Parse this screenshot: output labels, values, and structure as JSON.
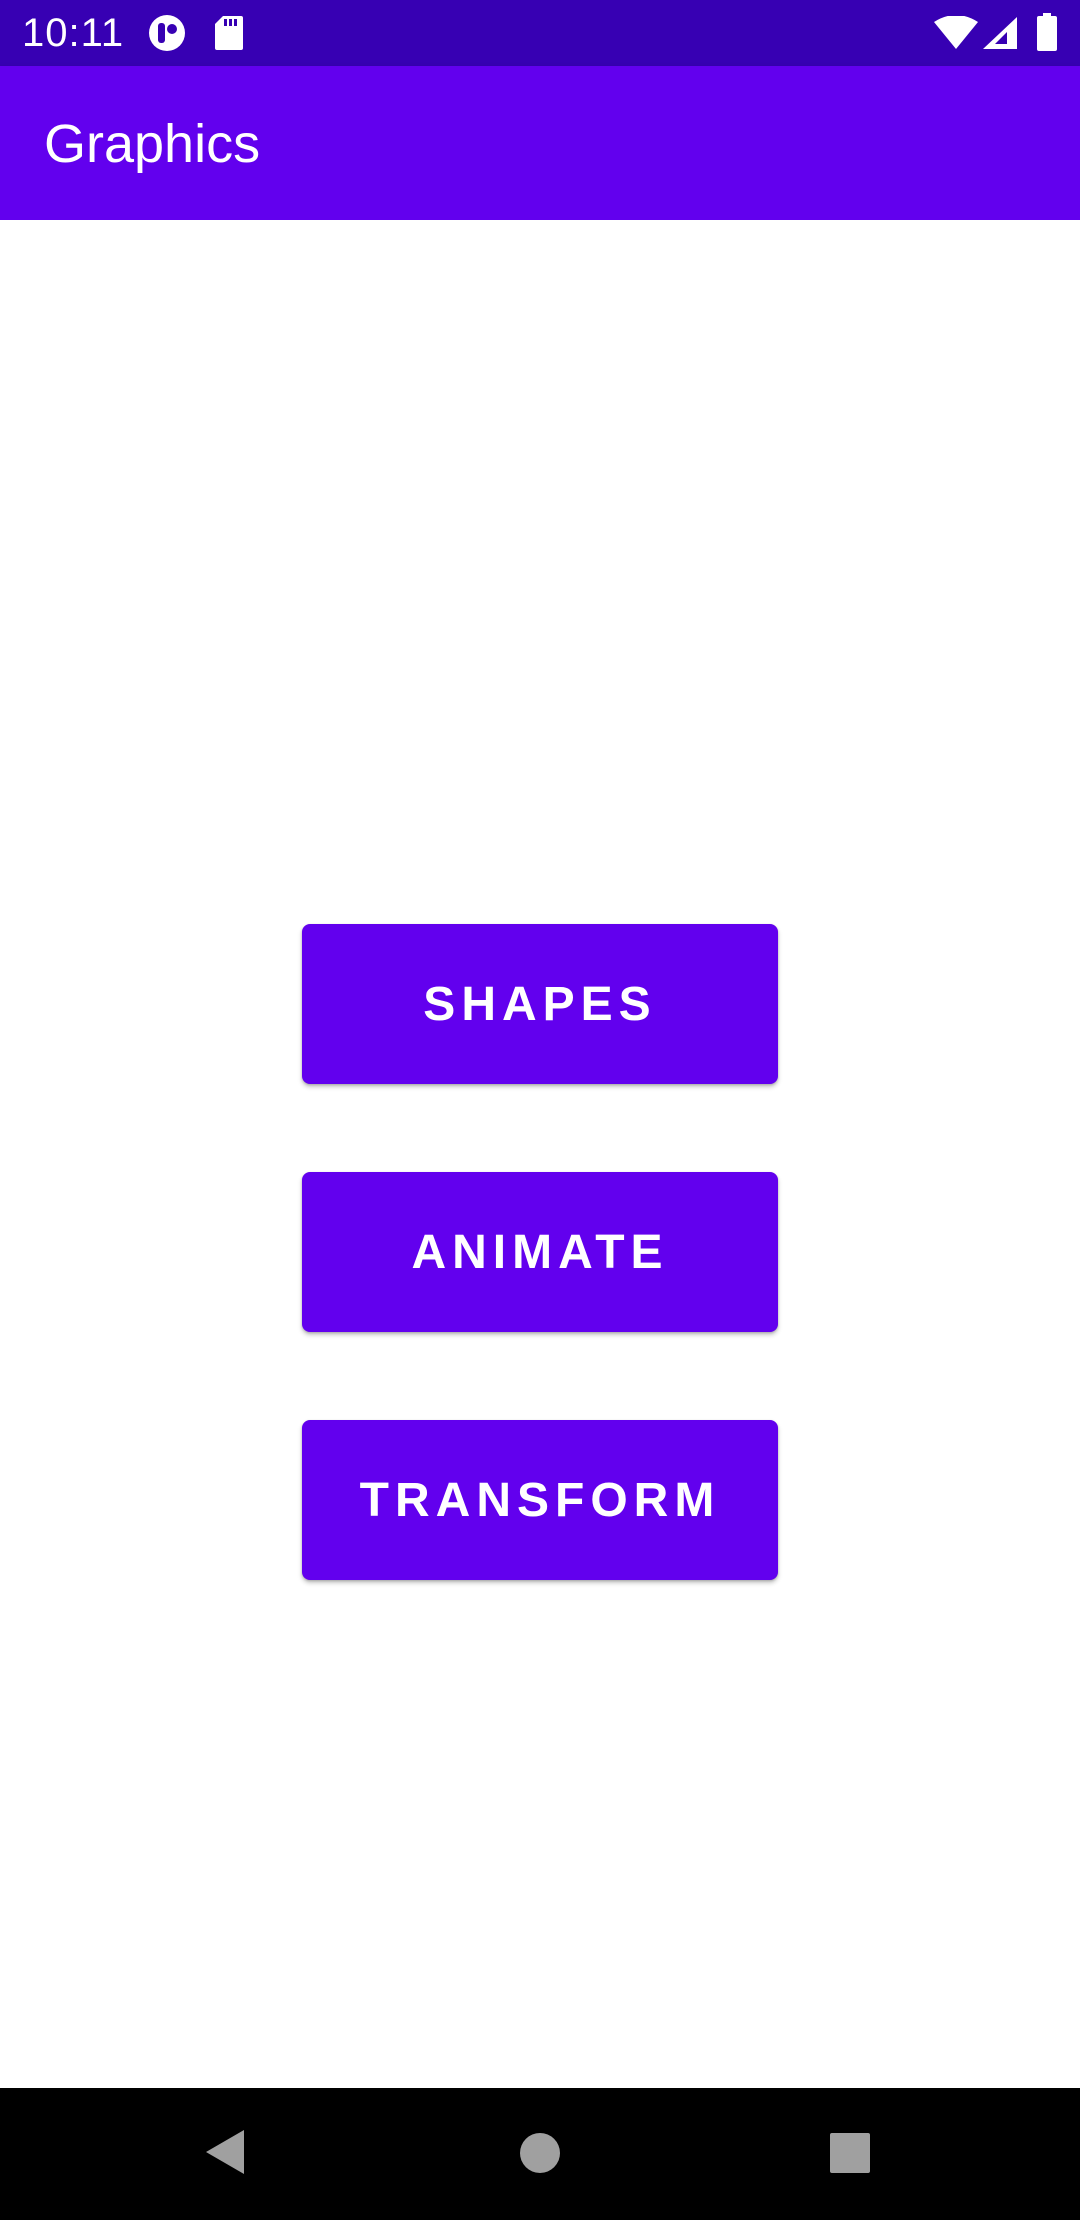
{
  "status_bar": {
    "time": "10:11",
    "left_icons": [
      "notification-app-icon",
      "sd-card-icon"
    ],
    "right_icons": [
      "wifi-icon",
      "cell-signal-icon",
      "battery-icon"
    ],
    "color": "#3700B3"
  },
  "app_bar": {
    "title": "Graphics",
    "color": "#6200EE"
  },
  "buttons": [
    {
      "label": "SHAPES"
    },
    {
      "label": "ANIMATE"
    },
    {
      "label": "TRANSFORM"
    }
  ],
  "nav_bar": {
    "buttons": [
      "back-icon",
      "home-icon",
      "recents-icon"
    ]
  },
  "colors": {
    "primary": "#6200EE",
    "primary_dark": "#3700B3",
    "on_primary": "#FFFFFF",
    "background": "#FFFFFF"
  }
}
